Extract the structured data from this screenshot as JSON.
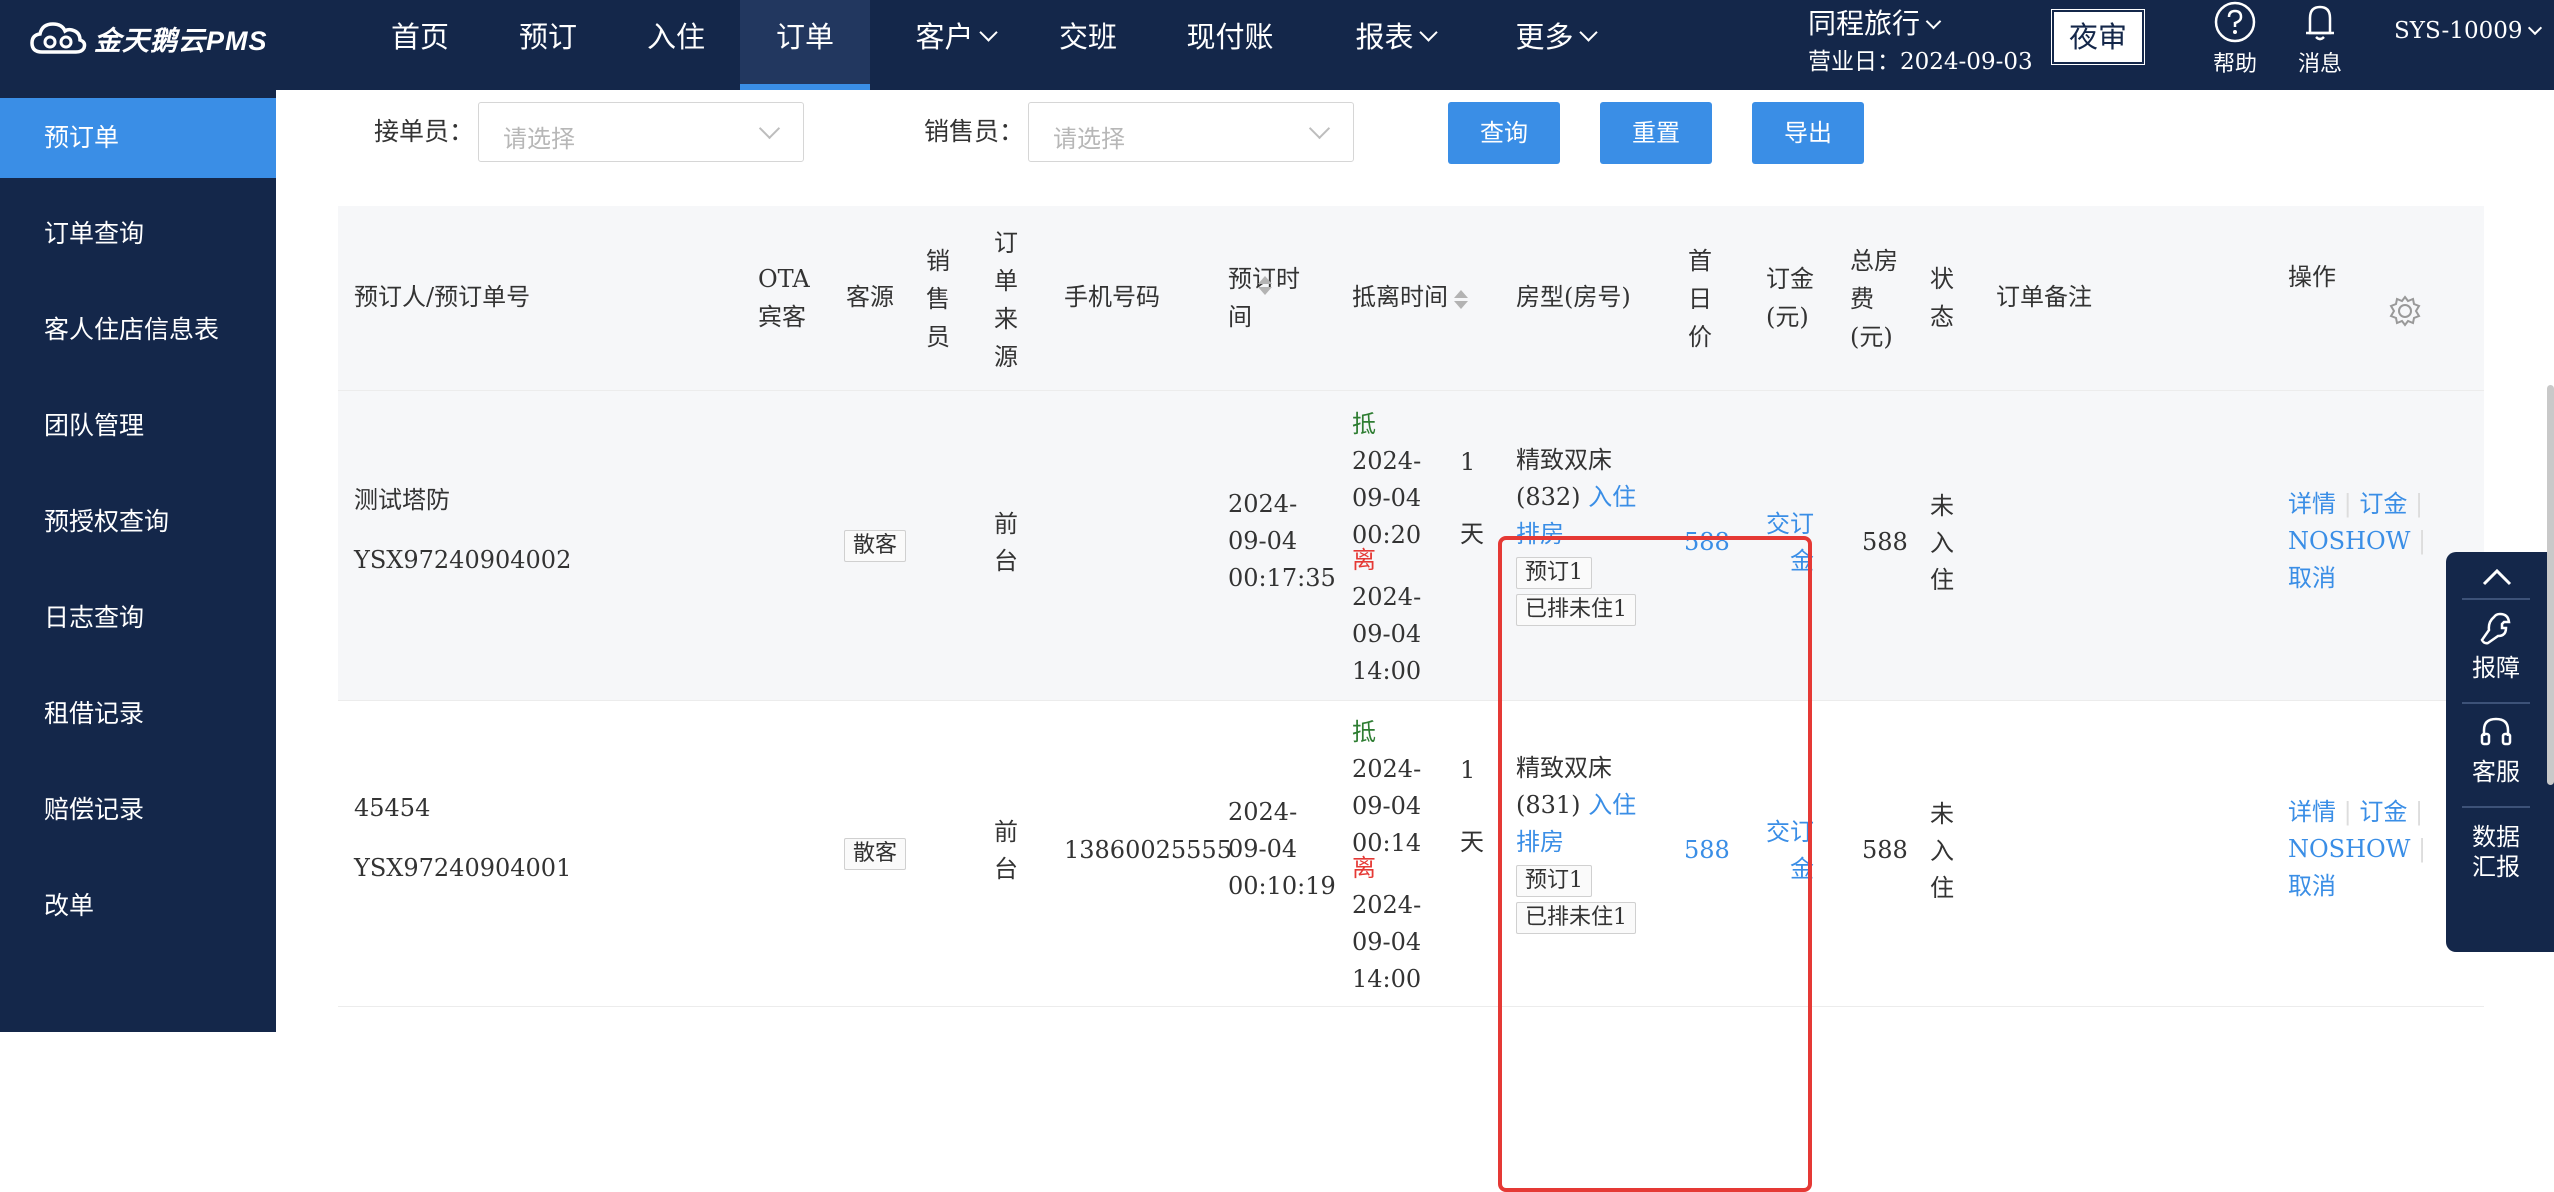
{
  "app": {
    "logo_text": "金天鹅云PMS"
  },
  "nav": {
    "items": [
      {
        "label": "首页"
      },
      {
        "label": "预订"
      },
      {
        "label": "入住"
      },
      {
        "label": "订单"
      },
      {
        "label": "客户"
      },
      {
        "label": "交班"
      },
      {
        "label": "现付账"
      },
      {
        "label": "报表"
      },
      {
        "label": "更多"
      }
    ],
    "active": "订单"
  },
  "header": {
    "hotel": "同程旅行",
    "business_date_label": "营业日：",
    "business_date": "2024-09-03",
    "night_audit": "夜审",
    "help": "帮助",
    "messages": "消息",
    "user": "SYS-10009"
  },
  "sidebar": {
    "items": [
      {
        "label": "预订单"
      },
      {
        "label": "订单查询"
      },
      {
        "label": "客人住店信息表"
      },
      {
        "label": "团队管理"
      },
      {
        "label": "预授权查询"
      },
      {
        "label": "日志查询"
      },
      {
        "label": "租借记录"
      },
      {
        "label": "赔偿记录"
      },
      {
        "label": "改单"
      }
    ],
    "active": "预订单"
  },
  "filters": {
    "receiver_label": "接单员：",
    "receiver_placeholder": "请选择",
    "sales_label": "销售员：",
    "sales_placeholder": "请选择",
    "query": "查询",
    "reset": "重置",
    "export": "导出"
  },
  "table": {
    "columns": {
      "booker": "预订人/预订单号",
      "ota_guest": "OTA宾客",
      "source": "客源",
      "salesperson": "销售员",
      "order_source": "订单来源",
      "phone": "手机号码",
      "booking_time": "预订时间",
      "arrival_departure": "抵离时间",
      "room_type": "房型(房号)",
      "first_day_price": "首日价",
      "deposit": "订金(元)",
      "total_room_fee": "总房费(元)",
      "status": "状态",
      "remark": "订单备注",
      "actions": "操作"
    },
    "rows": [
      {
        "booker_name": "测试塔防",
        "order_no": "YSX97240904002",
        "source": "散客",
        "order_source": "前台",
        "phone": "",
        "booking_time": "2024-09-04 00:17:35",
        "arrive_tag": "抵",
        "arrive_time": "2024-09-04 00:20",
        "depart_tag": "离",
        "depart_time": "2024-09-04 14:00",
        "nights": "1天",
        "room_type": "精致双床",
        "room_no": "(832)",
        "checkin_link": "入住",
        "arrange_link": "排房",
        "booking_tag": "预订1",
        "arranged_tag": "已排未住1",
        "first_day_price": "588",
        "deposit_link": "交订金",
        "total_fee": "588",
        "status": "未入住",
        "actions": {
          "detail": "详情",
          "deposit": "订金",
          "noshow": "NOSHOW",
          "cancel": "取消"
        }
      },
      {
        "booker_name": "45454",
        "order_no": "YSX97240904001",
        "source": "散客",
        "order_source": "前台",
        "phone": "13860025555",
        "booking_time": "2024-09-04 00:10:19",
        "arrive_tag": "抵",
        "arrive_time": "2024-09-04 00:14",
        "depart_tag": "离",
        "depart_time": "2024-09-04 14:00",
        "nights": "1天",
        "room_type": "精致双床",
        "room_no": "(831)",
        "checkin_link": "入住",
        "arrange_link": "排房",
        "booking_tag": "预订1",
        "arranged_tag": "已排未住1",
        "first_day_price": "588",
        "deposit_link": "交订金",
        "total_fee": "588",
        "status": "未入住",
        "actions": {
          "detail": "详情",
          "deposit": "订金",
          "noshow": "NOSHOW",
          "cancel": "取消"
        }
      }
    ]
  },
  "float_panel": {
    "report_issue": "报障",
    "service": "客服",
    "data_report": "数据汇报"
  },
  "colors": {
    "nav_bg": "#14274a",
    "accent": "#3a8ee6",
    "highlight": "#e53935"
  }
}
